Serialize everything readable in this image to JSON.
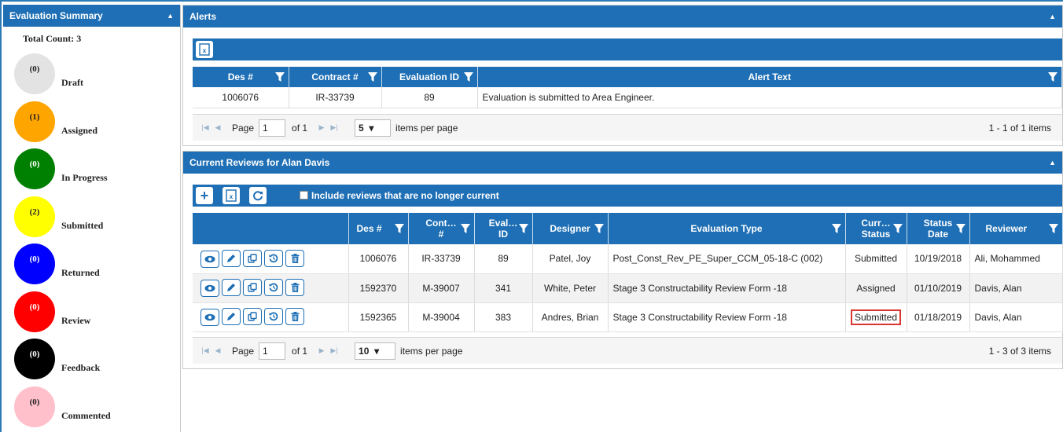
{
  "summary": {
    "title": "Evaluation Summary",
    "total": "Total Count: 3",
    "statuses": [
      {
        "count": "(0)",
        "label": "Draft",
        "color": "#e3e3e3",
        "text_color": "#222222"
      },
      {
        "count": "(1)",
        "label": "Assigned",
        "color": "#ffa500",
        "text_color": "#222222"
      },
      {
        "count": "(0)",
        "label": "In Progress",
        "color": "#008000",
        "text_color": "#ffffff"
      },
      {
        "count": "(2)",
        "label": "Submitted",
        "color": "#ffff00",
        "text_color": "#222222"
      },
      {
        "count": "(0)",
        "label": "Returned",
        "color": "#0000ff",
        "text_color": "#ffffff"
      },
      {
        "count": "(0)",
        "label": "Review",
        "color": "#ff0000",
        "text_color": "#ffffff"
      },
      {
        "count": "(0)",
        "label": "Feedback",
        "color": "#000000",
        "text_color": "#ffffff"
      },
      {
        "count": "(0)",
        "label": "Commented",
        "color": "#ffc0cb",
        "text_color": "#222222"
      }
    ]
  },
  "alerts": {
    "title": "Alerts",
    "columns": [
      "Des #",
      "Contract #",
      "Evaluation ID",
      "Alert Text"
    ],
    "rows": [
      {
        "des": "1006076",
        "contract": "IR-33739",
        "eval_id": "89",
        "text": "Evaluation is submitted to Area Engineer."
      }
    ],
    "pager": {
      "page_label": "Page",
      "page": "1",
      "of": "of 1",
      "per_page": "5",
      "per_page_label": "items per page",
      "range": "1 - 1 of 1 items"
    }
  },
  "reviews": {
    "title": "Current Reviews for Alan Davis",
    "include_label": "Include reviews that are no longer current",
    "columns": {
      "des": "Des #",
      "contract_1": "Cont…",
      "contract_2": "#",
      "eval_1": "Eval…",
      "eval_2": "ID",
      "designer": "Designer",
      "type": "Evaluation Type",
      "status_1": "Curr…",
      "status_2": "Status",
      "date_1": "Status",
      "date_2": "Date",
      "reviewer": "Reviewer"
    },
    "rows": [
      {
        "des": "1006076",
        "contract": "IR-33739",
        "eval_id": "89",
        "designer": "Patel, Joy",
        "type": "Post_Const_Rev_PE_Super_CCM_05-18-C (002)",
        "status": "Submitted",
        "date": "10/19/2018",
        "reviewer": "Ali, Mohammed"
      },
      {
        "des": "1592370",
        "contract": "M-39007",
        "eval_id": "341",
        "designer": "White, Peter",
        "type": "Stage 3 Constructability Review Form -18",
        "status": "Assigned",
        "date": "01/10/2019",
        "reviewer": "Davis, Alan"
      },
      {
        "des": "1592365",
        "contract": "M-39004",
        "eval_id": "383",
        "designer": "Andres, Brian",
        "type": "Stage 3 Constructability Review Form -18",
        "status": "Submitted",
        "date": "01/18/2019",
        "reviewer": "Davis, Alan"
      }
    ],
    "pager": {
      "page_label": "Page",
      "page": "1",
      "of": "of 1",
      "per_page": "10",
      "per_page_label": "items per page",
      "range": "1 - 3 of 3 items"
    }
  }
}
